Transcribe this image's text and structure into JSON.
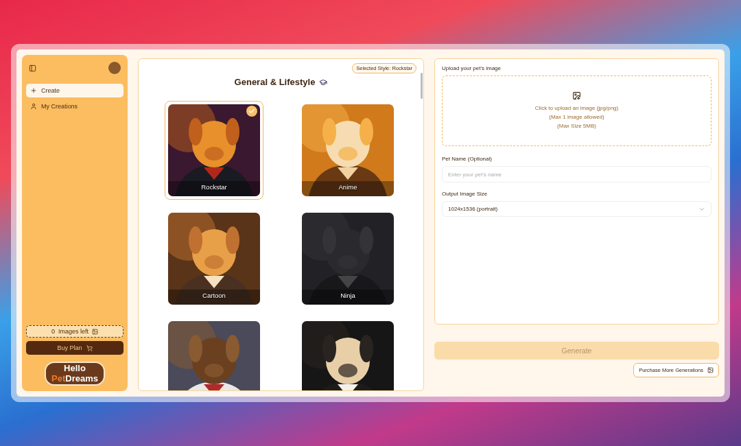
{
  "sidebar": {
    "items": [
      {
        "label": "Create",
        "kind": "create",
        "selected": true
      },
      {
        "label": "My Creations",
        "kind": "creations",
        "selected": false
      }
    ],
    "credits": {
      "count": "0",
      "label": "Images left"
    },
    "buy_button": "Buy Plan",
    "logo": {
      "line1": "Hello",
      "line2_accent": "Pet",
      "line2_rest": "Dreams"
    }
  },
  "styles_panel": {
    "badge": "Selected Style: Rockstar",
    "heading": "General & Lifestyle",
    "styles": [
      {
        "label": "Rockstar",
        "kind": "rockstar",
        "selected": true
      },
      {
        "label": "Anime",
        "kind": "anime",
        "selected": false
      },
      {
        "label": "Cartoon",
        "kind": "cartoon",
        "selected": false
      },
      {
        "label": "Ninja",
        "kind": "ninja",
        "selected": false
      },
      {
        "kind": "astronaut",
        "selected": false
      },
      {
        "kind": "suit",
        "selected": false
      }
    ]
  },
  "form": {
    "upload_label": "Upload your pet's image",
    "upload_lines": [
      "Click to upload an image (jpg/png)",
      "(Max 1 image allowed)",
      "(Max Size 5MB)"
    ],
    "name_label": "Pet Name (Optional)",
    "name_placeholder": "Enter your pet's name",
    "size_label": "Output Image Size",
    "size_value": "1024x1536 (portrait)"
  },
  "generate": {
    "label": "Generate",
    "disabled": true
  },
  "purchase_button": "Purchase More Generations"
}
